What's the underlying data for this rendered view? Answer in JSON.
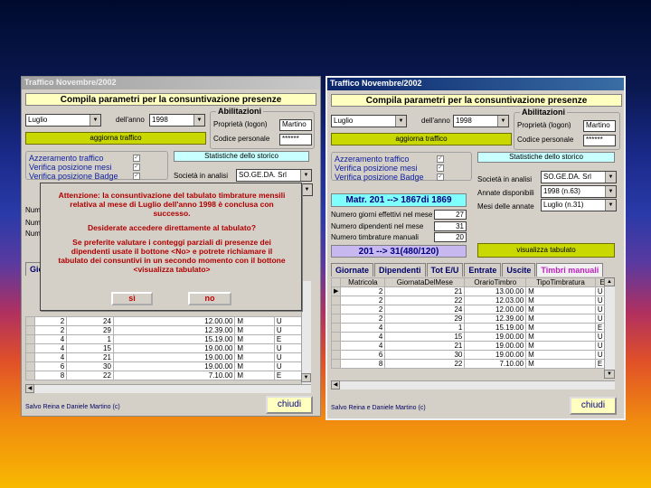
{
  "window_title": "Traffico Novembre/2002",
  "header": "Compila parametri per la consuntivazione presenze",
  "month": "Luglio",
  "year_label": "dell'anno",
  "year": "1998",
  "update_button": "aggiorna traffico",
  "abilitazioni": {
    "title": "Abilitazioni",
    "owner_label": "Proprietà (logon)",
    "owner_value": "Martino",
    "code_label": "Codice personale",
    "code_value": "******"
  },
  "options": {
    "opt1": "Azzeramento traffico",
    "opt2": "Verifica posizione mesi",
    "opt3": "Verifica posizione Badge"
  },
  "stats": {
    "title": "Statistiche dello storico",
    "company_label": "Società in analisi",
    "company_value": "SO.GE.DA. Srl",
    "years_label": "Annate disponibili",
    "years_value": "1998 (n.63)",
    "months_label": "Mesi delle annate",
    "months_value": "Luglio (n.31)",
    "view_button": "visualizza tabulato"
  },
  "matr": "Matr. 201 --> 1867di 1869",
  "counts": {
    "days_label": "Numero giorni effettivi nel mese",
    "days_value": "27",
    "emp_label": "Numero dipendenti nel mese",
    "emp_value": "31",
    "manual_label": "Numero timbrature manuali",
    "manual_value": "20"
  },
  "range": "201 --> 31(480/120)",
  "tabs": [
    "Giornate",
    "Dipendenti",
    "Tot E/U",
    "Entrate",
    "Uscite",
    "Timbri manuali"
  ],
  "columns": [
    "Matricola",
    "GiornataDelMese",
    "OrarioTimbro",
    "TipoTimbratura",
    "EU"
  ],
  "rows": [
    [
      "2",
      "21",
      "13.00.00",
      "M",
      "U"
    ],
    [
      "2",
      "22",
      "12.03.00",
      "M",
      "U"
    ],
    [
      "2",
      "24",
      "12.00.00",
      "M",
      "U"
    ],
    [
      "2",
      "29",
      "12.39.00",
      "M",
      "U"
    ],
    [
      "4",
      "1",
      "15.19.00",
      "M",
      "E"
    ],
    [
      "4",
      "15",
      "19.00.00",
      "M",
      "U"
    ],
    [
      "4",
      "21",
      "19.00.00",
      "M",
      "U"
    ],
    [
      "6",
      "30",
      "19.00.00",
      "M",
      "U"
    ],
    [
      "8",
      "22",
      "7.10.00",
      "M",
      "E"
    ]
  ],
  "left_rows": [
    [
      "2",
      "24",
      "12.00.00",
      "M",
      "U"
    ],
    [
      "2",
      "29",
      "12.39.00",
      "M",
      "U"
    ],
    [
      "4",
      "1",
      "15.19.00",
      "M",
      "E"
    ],
    [
      "4",
      "15",
      "19.00.00",
      "M",
      "U"
    ],
    [
      "4",
      "21",
      "19.00.00",
      "M",
      "U"
    ],
    [
      "6",
      "30",
      "19.00.00",
      "M",
      "U"
    ],
    [
      "8",
      "22",
      "7.10.00",
      "M",
      "E"
    ]
  ],
  "left_partial": {
    "tab_first": "Gio",
    "label_prefix": "Num"
  },
  "footer": "Salvo Reina e Daniele Martino (c)",
  "close_button": "chiudi",
  "dialog": {
    "line1": "Attenzione: la consuntivazione del tabulato timbrature mensili",
    "line2": "relativa al mese di Luglio dell'anno 1998 è conclusa con",
    "line3": "successo.",
    "line4": "Desiderate accedere direttamente al tabulato?",
    "line5": "Se preferite valutare i conteggi parziali di presenze dei",
    "line6": "dipendenti usate il bottone <No> e potrete richiamare il",
    "line7": "tabulato dei consuntivi in un secondo momento con il bottone",
    "line8": "<visualizza tabulato>",
    "yes": "sì",
    "no": "no"
  }
}
